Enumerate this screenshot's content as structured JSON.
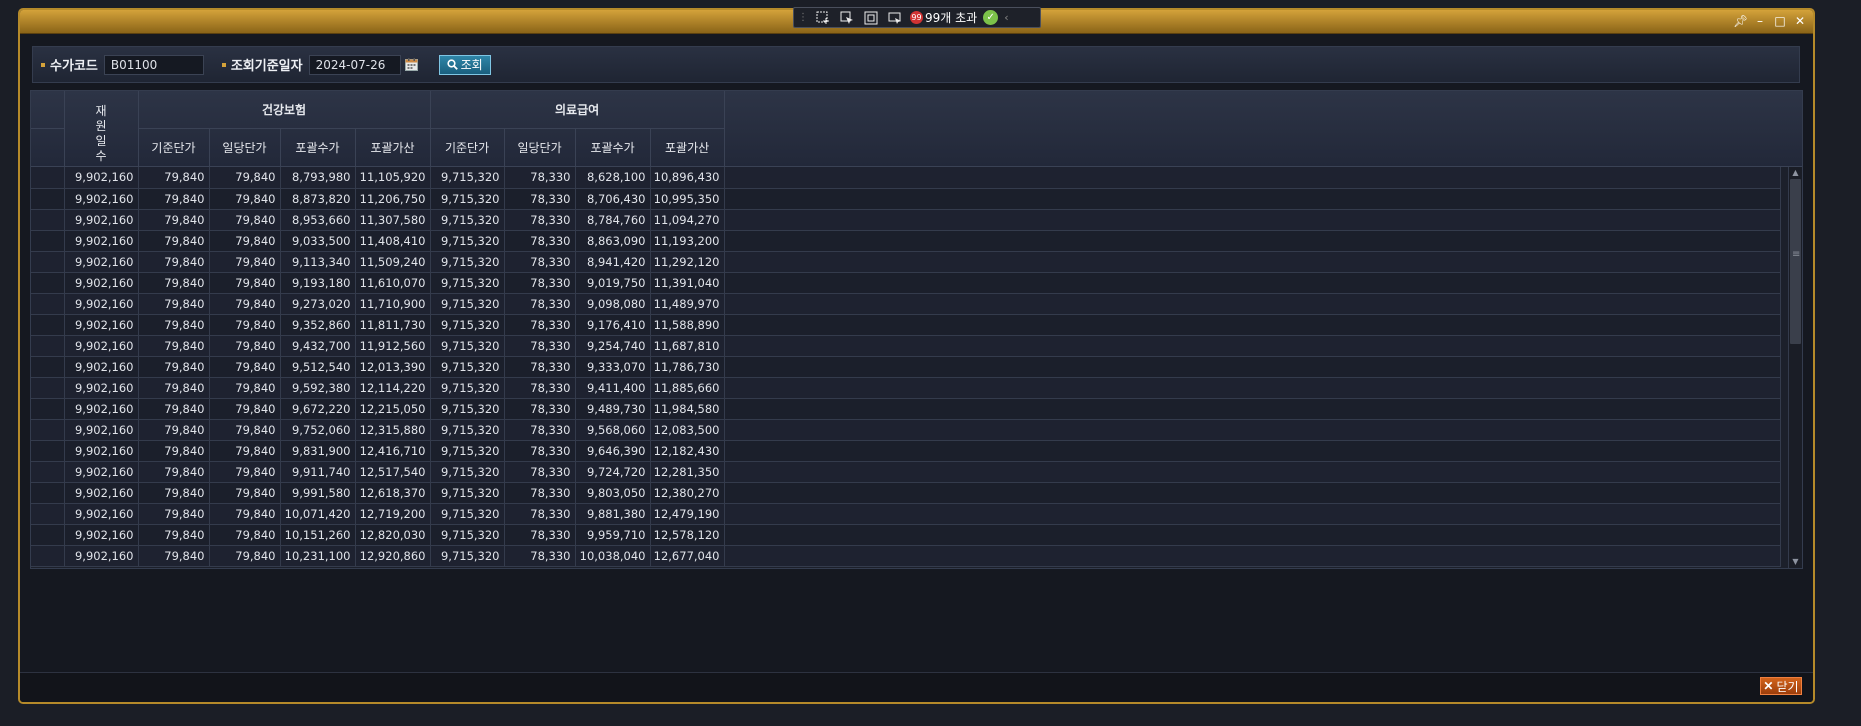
{
  "toolbar": {
    "counter_text": "99개 초과",
    "badge_text": "99"
  },
  "search": {
    "code_label": "수가코드",
    "code_value": "B01100",
    "date_label": "조회기준일자",
    "date_value": "2024-07-26",
    "search_button": "조회"
  },
  "grid": {
    "first_col_header": "재원일수",
    "groups": [
      "건강보험",
      "의료급여"
    ],
    "subheaders": [
      "기준단가",
      "일당단가",
      "포괄수가",
      "포괄가산",
      "기준단가",
      "일당단가",
      "포괄수가",
      "포괄가산"
    ],
    "rows": [
      [
        "9,902,160",
        "79,840",
        "79,840",
        "8,793,980",
        "11,105,920",
        "9,715,320",
        "78,330",
        "8,628,100",
        "10,896,430"
      ],
      [
        "9,902,160",
        "79,840",
        "79,840",
        "8,873,820",
        "11,206,750",
        "9,715,320",
        "78,330",
        "8,706,430",
        "10,995,350"
      ],
      [
        "9,902,160",
        "79,840",
        "79,840",
        "8,953,660",
        "11,307,580",
        "9,715,320",
        "78,330",
        "8,784,760",
        "11,094,270"
      ],
      [
        "9,902,160",
        "79,840",
        "79,840",
        "9,033,500",
        "11,408,410",
        "9,715,320",
        "78,330",
        "8,863,090",
        "11,193,200"
      ],
      [
        "9,902,160",
        "79,840",
        "79,840",
        "9,113,340",
        "11,509,240",
        "9,715,320",
        "78,330",
        "8,941,420",
        "11,292,120"
      ],
      [
        "9,902,160",
        "79,840",
        "79,840",
        "9,193,180",
        "11,610,070",
        "9,715,320",
        "78,330",
        "9,019,750",
        "11,391,040"
      ],
      [
        "9,902,160",
        "79,840",
        "79,840",
        "9,273,020",
        "11,710,900",
        "9,715,320",
        "78,330",
        "9,098,080",
        "11,489,970"
      ],
      [
        "9,902,160",
        "79,840",
        "79,840",
        "9,352,860",
        "11,811,730",
        "9,715,320",
        "78,330",
        "9,176,410",
        "11,588,890"
      ],
      [
        "9,902,160",
        "79,840",
        "79,840",
        "9,432,700",
        "11,912,560",
        "9,715,320",
        "78,330",
        "9,254,740",
        "11,687,810"
      ],
      [
        "9,902,160",
        "79,840",
        "79,840",
        "9,512,540",
        "12,013,390",
        "9,715,320",
        "78,330",
        "9,333,070",
        "11,786,730"
      ],
      [
        "9,902,160",
        "79,840",
        "79,840",
        "9,592,380",
        "12,114,220",
        "9,715,320",
        "78,330",
        "9,411,400",
        "11,885,660"
      ],
      [
        "9,902,160",
        "79,840",
        "79,840",
        "9,672,220",
        "12,215,050",
        "9,715,320",
        "78,330",
        "9,489,730",
        "11,984,580"
      ],
      [
        "9,902,160",
        "79,840",
        "79,840",
        "9,752,060",
        "12,315,880",
        "9,715,320",
        "78,330",
        "9,568,060",
        "12,083,500"
      ],
      [
        "9,902,160",
        "79,840",
        "79,840",
        "9,831,900",
        "12,416,710",
        "9,715,320",
        "78,330",
        "9,646,390",
        "12,182,430"
      ],
      [
        "9,902,160",
        "79,840",
        "79,840",
        "9,911,740",
        "12,517,540",
        "9,715,320",
        "78,330",
        "9,724,720",
        "12,281,350"
      ],
      [
        "9,902,160",
        "79,840",
        "79,840",
        "9,991,580",
        "12,618,370",
        "9,715,320",
        "78,330",
        "9,803,050",
        "12,380,270"
      ],
      [
        "9,902,160",
        "79,840",
        "79,840",
        "10,071,420",
        "12,719,200",
        "9,715,320",
        "78,330",
        "9,881,380",
        "12,479,190"
      ],
      [
        "9,902,160",
        "79,840",
        "79,840",
        "10,151,260",
        "12,820,030",
        "9,715,320",
        "78,330",
        "9,959,710",
        "12,578,120"
      ],
      [
        "9,902,160",
        "79,840",
        "79,840",
        "10,231,100",
        "12,920,860",
        "9,715,320",
        "78,330",
        "10,038,040",
        "12,677,040"
      ]
    ]
  },
  "footer": {
    "close_label": "닫기"
  },
  "colors": {
    "frame_gold": "#b58a2a",
    "search_button": "#1a5f7e",
    "close_button": "#c4521a"
  }
}
